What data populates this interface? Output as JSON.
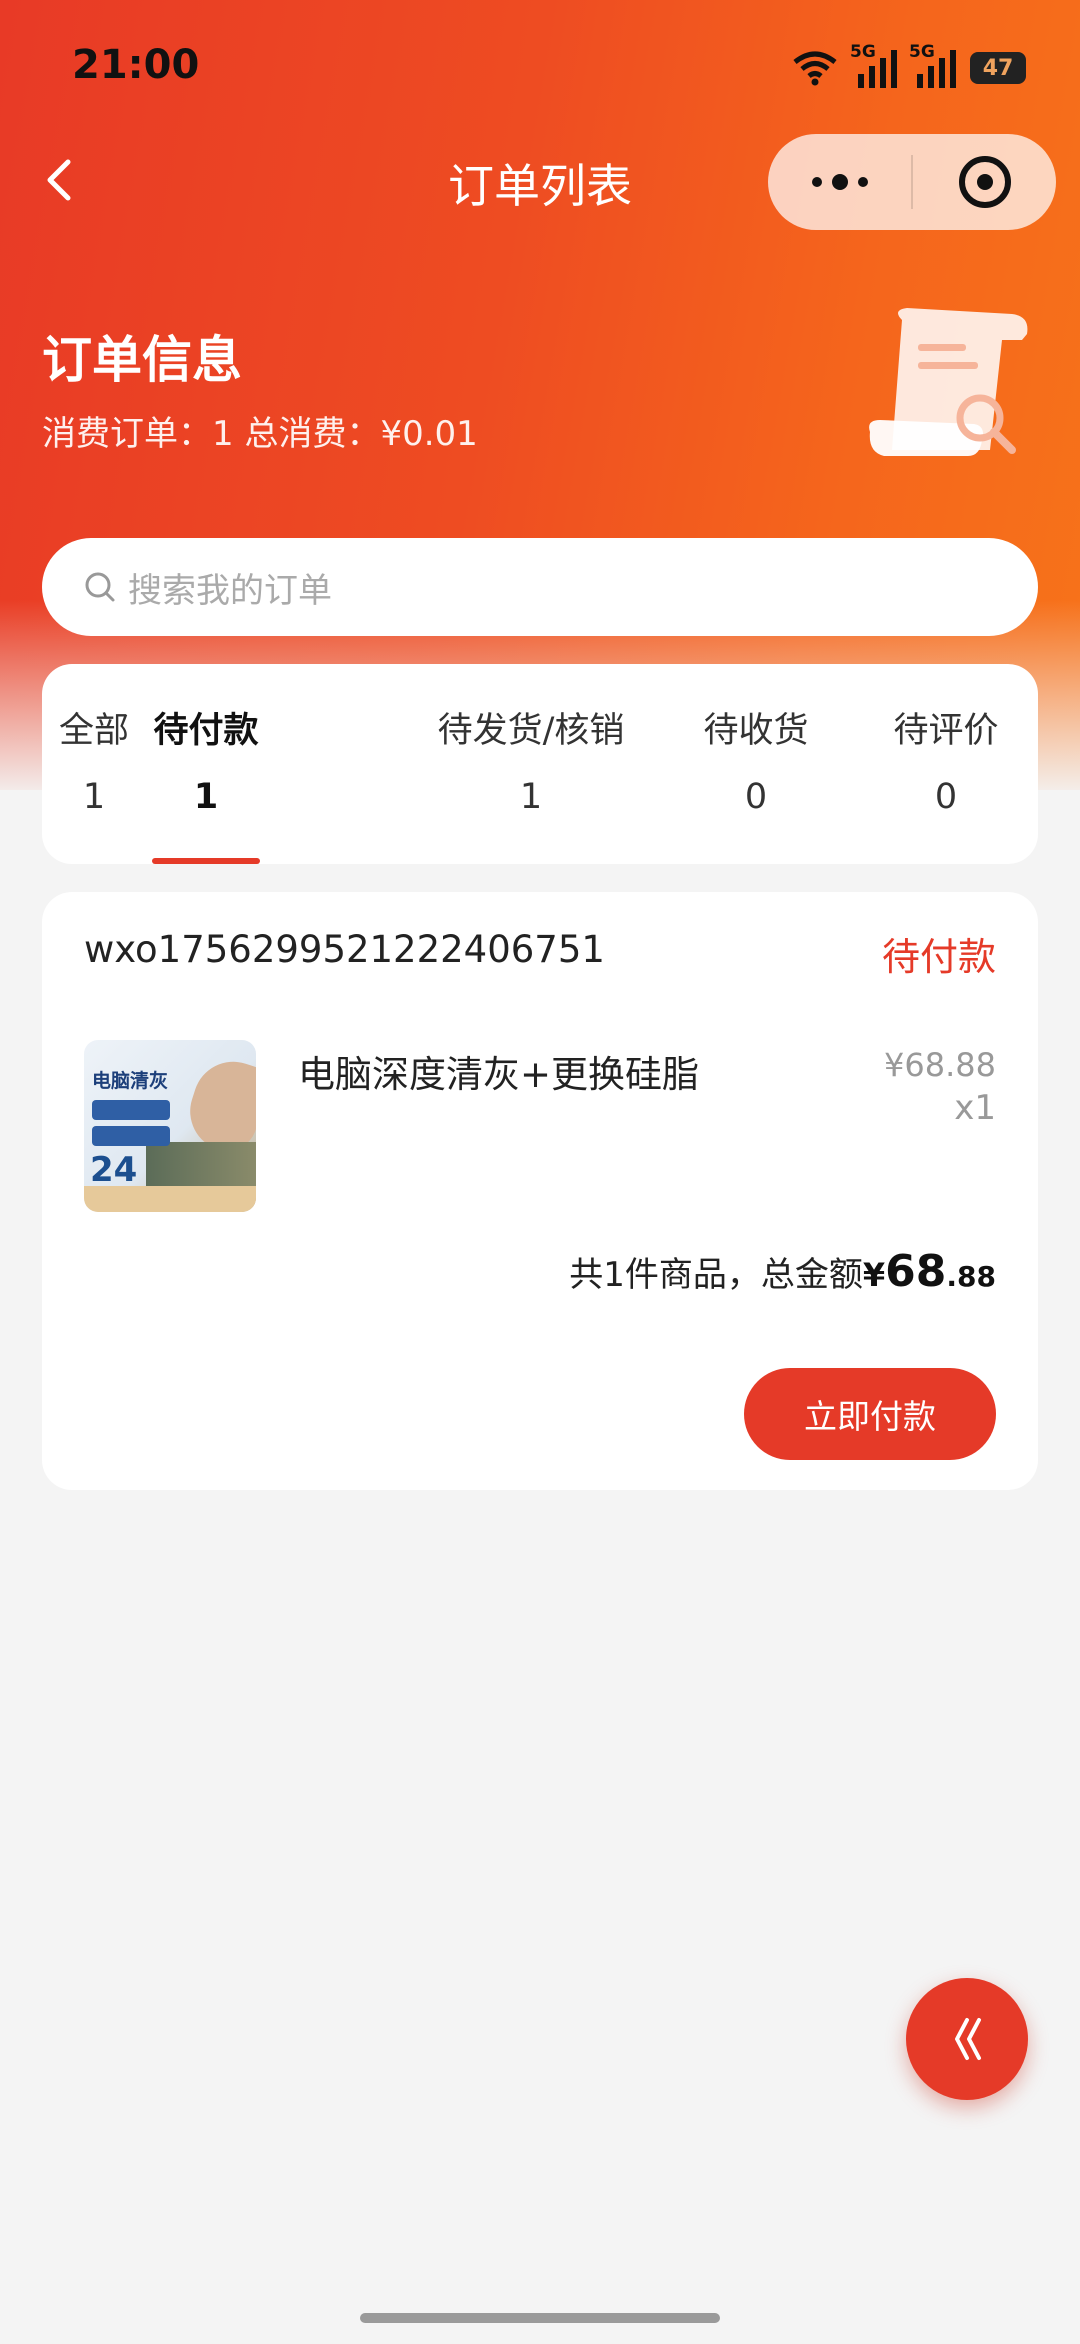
{
  "status_bar": {
    "time": "21:00",
    "network_label_1": "5G",
    "network_label_2": "5G",
    "battery": "47"
  },
  "nav": {
    "title": "订单列表"
  },
  "summary": {
    "title": "订单信息",
    "subtitle": "消费订单：1 总消费：¥0.01"
  },
  "search": {
    "placeholder": "搜索我的订单"
  },
  "tabs": [
    {
      "label": "全部",
      "count": "1"
    },
    {
      "label": "待付款",
      "count": "1"
    },
    {
      "label": "待发货/核销",
      "count": "1"
    },
    {
      "label": "待收货",
      "count": "0"
    },
    {
      "label": "待评价",
      "count": "0"
    }
  ],
  "active_tab": "待付款",
  "order": {
    "number": "wxo1756299521222406751",
    "status": "待付款",
    "thumbnail_text": {
      "title": "电脑清灰",
      "number": "24"
    },
    "product_name": "电脑深度清灰+更换硅脂",
    "unit_price": "¥68.88",
    "quantity": "x1",
    "total_prefix": "共1件商品，总金额",
    "total_currency": "¥",
    "total_integer": "68",
    "total_decimal": ".88",
    "pay_button": "立即付款"
  },
  "colors": {
    "accent": "#e53a28",
    "hero_start": "#e83a26",
    "hero_end": "#f7731a",
    "page_bg": "#f4f4f4"
  }
}
